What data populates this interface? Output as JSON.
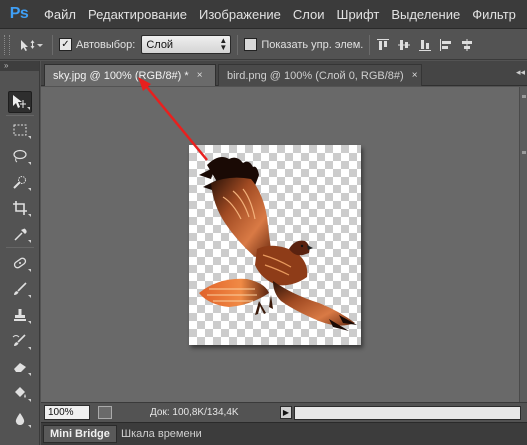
{
  "app": {
    "logo": "Ps",
    "menu": [
      "Файл",
      "Редактирование",
      "Изображение",
      "Слои",
      "Шрифт",
      "Выделение",
      "Фильтр"
    ]
  },
  "options_bar": {
    "auto_select_label": "Автовыбор:",
    "auto_select_checked": true,
    "auto_select_target": "Слой",
    "show_transform_label": "Показать упр. элем.",
    "show_transform_checked": false
  },
  "tabs": [
    {
      "label": "sky.jpg @ 100% (RGB/8#) *",
      "active": true
    },
    {
      "label": "bird.png @ 100% (Слой 0, RGB/8#)",
      "active": false
    }
  ],
  "tab_close_glyph": "×",
  "status": {
    "zoom": "100%",
    "doc_size": "Док: 100,8K/134,4K"
  },
  "bottom_panels": [
    "Mini Bridge",
    "Шкала времени"
  ],
  "colors": {
    "menu_bg": "#3b3b3b",
    "canvas_bg": "#696969",
    "annotation_arrow": "#e8201e"
  },
  "tools": [
    "move-tool-icon",
    "marquee-tool-icon",
    "lasso-tool-icon",
    "quick-select-tool-icon",
    "crop-tool-icon",
    "eyedropper-tool-icon",
    "healing-brush-tool-icon",
    "brush-tool-icon",
    "clone-stamp-tool-icon",
    "history-brush-tool-icon",
    "eraser-tool-icon",
    "paint-bucket-tool-icon",
    "blur-tool-icon"
  ]
}
